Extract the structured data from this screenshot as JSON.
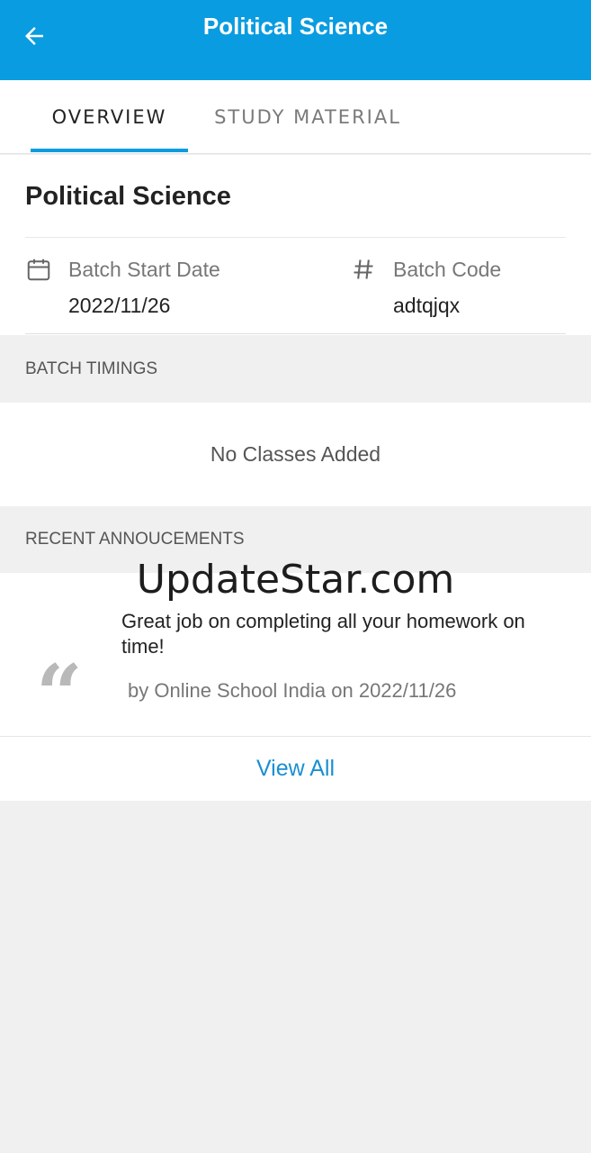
{
  "appbar": {
    "title": "Political Science"
  },
  "tabs": [
    {
      "label": "OVERVIEW"
    },
    {
      "label": "STUDY MATERIAL"
    }
  ],
  "overview": {
    "title": "Political Science",
    "batch_start": {
      "label": "Batch Start Date",
      "value": "2022/11/26",
      "icon": "calendar-icon"
    },
    "batch_code": {
      "label": "Batch Code",
      "value": "adtqjqx",
      "icon": "hash-icon"
    }
  },
  "batch_timings": {
    "header": "BATCH TIMINGS",
    "empty_text": "No Classes Added"
  },
  "announcements": {
    "header": "RECENT ANNOUCEMENTS",
    "items": [
      {
        "text": "Great job on completing all your homework on time!",
        "meta": "by Online School India on 2022/11/26"
      }
    ],
    "view_all": "View All"
  },
  "watermark": "UpdateStar.com",
  "colors": {
    "primary": "#0a9ce0",
    "link": "#1a8fd1",
    "background": "#f0f0f0"
  }
}
